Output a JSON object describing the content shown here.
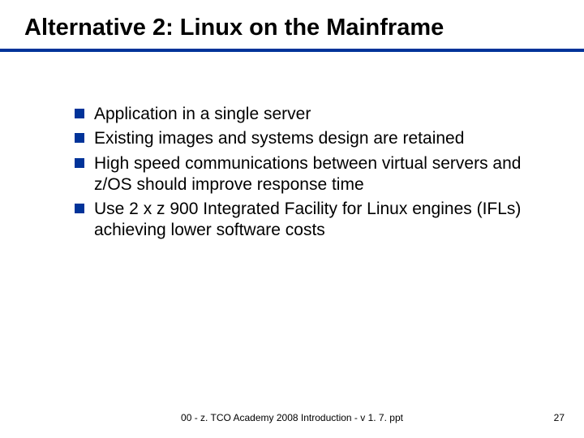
{
  "title": "Alternative 2: Linux on the Mainframe",
  "bullets": [
    "Application in a single server",
    "Existing images and systems design are retained",
    "High speed communications between virtual servers and z/OS should improve response time",
    "Use 2 x z 900 Integrated Facility for Linux engines (IFLs) achieving lower software costs"
  ],
  "footer": {
    "center": "00 - z. TCO Academy 2008 Introduction - v 1. 7. ppt",
    "page": "27"
  },
  "colors": {
    "accent": "#003399"
  }
}
